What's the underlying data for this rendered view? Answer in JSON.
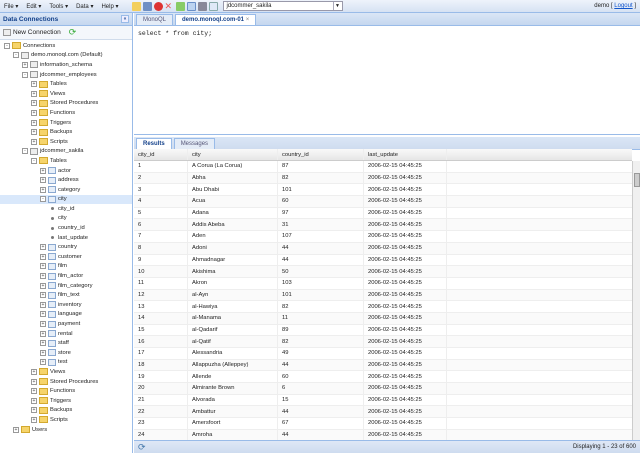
{
  "menu": [
    "File",
    "Edit",
    "Tools",
    "Data",
    "Help"
  ],
  "db_select": "jdcommer_sakila",
  "user": {
    "name": "demo",
    "logout": "Logout"
  },
  "left": {
    "title": "Data Connections",
    "new_connection": "New Connection"
  },
  "tree": [
    {
      "l": 0,
      "t": "f",
      "s": "-",
      "label": "Connections"
    },
    {
      "l": 1,
      "t": "d",
      "s": "-",
      "label": "demo.monoql.com (Default)"
    },
    {
      "l": 2,
      "t": "d",
      "s": "+",
      "label": "information_schema"
    },
    {
      "l": 2,
      "t": "d",
      "s": "-",
      "label": "jdcommer_employees"
    },
    {
      "l": 3,
      "t": "f",
      "s": "+",
      "label": "Tables"
    },
    {
      "l": 3,
      "t": "f",
      "s": "+",
      "label": "Views"
    },
    {
      "l": 3,
      "t": "f",
      "s": "+",
      "label": "Stored Procedures"
    },
    {
      "l": 3,
      "t": "f",
      "s": "+",
      "label": "Functions"
    },
    {
      "l": 3,
      "t": "f",
      "s": "+",
      "label": "Triggers"
    },
    {
      "l": 3,
      "t": "f",
      "s": "+",
      "label": "Backups"
    },
    {
      "l": 3,
      "t": "f",
      "s": "+",
      "label": "Scripts"
    },
    {
      "l": 2,
      "t": "d",
      "s": "-",
      "label": "jdcommer_sakila"
    },
    {
      "l": 3,
      "t": "f",
      "s": "-",
      "label": "Tables"
    },
    {
      "l": 4,
      "t": "t",
      "s": "+",
      "label": "actor"
    },
    {
      "l": 4,
      "t": "t",
      "s": "+",
      "label": "address"
    },
    {
      "l": 4,
      "t": "t",
      "s": "+",
      "label": "category"
    },
    {
      "l": 4,
      "t": "t",
      "s": "-",
      "label": "city",
      "sel": true
    },
    {
      "l": 5,
      "t": "c",
      "label": "city_id"
    },
    {
      "l": 5,
      "t": "c",
      "label": "city"
    },
    {
      "l": 5,
      "t": "c",
      "label": "country_id"
    },
    {
      "l": 5,
      "t": "c",
      "label": "last_update"
    },
    {
      "l": 4,
      "t": "t",
      "s": "+",
      "label": "country"
    },
    {
      "l": 4,
      "t": "t",
      "s": "+",
      "label": "customer"
    },
    {
      "l": 4,
      "t": "t",
      "s": "+",
      "label": "film"
    },
    {
      "l": 4,
      "t": "t",
      "s": "+",
      "label": "film_actor"
    },
    {
      "l": 4,
      "t": "t",
      "s": "+",
      "label": "film_category"
    },
    {
      "l": 4,
      "t": "t",
      "s": "+",
      "label": "film_text"
    },
    {
      "l": 4,
      "t": "t",
      "s": "+",
      "label": "inventory"
    },
    {
      "l": 4,
      "t": "t",
      "s": "+",
      "label": "language"
    },
    {
      "l": 4,
      "t": "t",
      "s": "+",
      "label": "payment"
    },
    {
      "l": 4,
      "t": "t",
      "s": "+",
      "label": "rental"
    },
    {
      "l": 4,
      "t": "t",
      "s": "+",
      "label": "staff"
    },
    {
      "l": 4,
      "t": "t",
      "s": "+",
      "label": "store"
    },
    {
      "l": 4,
      "t": "t",
      "s": "+",
      "label": "test"
    },
    {
      "l": 3,
      "t": "f",
      "s": "+",
      "label": "Views"
    },
    {
      "l": 3,
      "t": "f",
      "s": "+",
      "label": "Stored Procedures"
    },
    {
      "l": 3,
      "t": "f",
      "s": "+",
      "label": "Functions"
    },
    {
      "l": 3,
      "t": "f",
      "s": "+",
      "label": "Triggers"
    },
    {
      "l": 3,
      "t": "f",
      "s": "+",
      "label": "Backups"
    },
    {
      "l": 3,
      "t": "f",
      "s": "+",
      "label": "Scripts"
    },
    {
      "l": 1,
      "t": "f",
      "s": "+",
      "label": "Users"
    }
  ],
  "tabs": [
    "MonoQL",
    "demo.monoql.com-01"
  ],
  "editor": {
    "sql": "select * from city;"
  },
  "result_tabs": [
    "Results",
    "Messages"
  ],
  "columns": [
    "city_id",
    "city",
    "country_id",
    "last_update"
  ],
  "rows": [
    [
      "1",
      "A Corua (La Corua)",
      "87",
      "2006-02-15 04:45:25"
    ],
    [
      "2",
      "Abha",
      "82",
      "2006-02-15 04:45:25"
    ],
    [
      "3",
      "Abu Dhabi",
      "101",
      "2006-02-15 04:45:25"
    ],
    [
      "4",
      "Acua",
      "60",
      "2006-02-15 04:45:25"
    ],
    [
      "5",
      "Adana",
      "97",
      "2006-02-15 04:45:25"
    ],
    [
      "6",
      "Addis Abeba",
      "31",
      "2006-02-15 04:45:25"
    ],
    [
      "7",
      "Aden",
      "107",
      "2006-02-15 04:45:25"
    ],
    [
      "8",
      "Adoni",
      "44",
      "2006-02-15 04:45:25"
    ],
    [
      "9",
      "Ahmadnagar",
      "44",
      "2006-02-15 04:45:25"
    ],
    [
      "10",
      "Akishima",
      "50",
      "2006-02-15 04:45:25"
    ],
    [
      "11",
      "Akron",
      "103",
      "2006-02-15 04:45:25"
    ],
    [
      "12",
      "al-Ayn",
      "101",
      "2006-02-15 04:45:25"
    ],
    [
      "13",
      "al-Hawiya",
      "82",
      "2006-02-15 04:45:25"
    ],
    [
      "14",
      "al-Manama",
      "11",
      "2006-02-15 04:45:25"
    ],
    [
      "15",
      "al-Qadarif",
      "89",
      "2006-02-15 04:45:25"
    ],
    [
      "16",
      "al-Qatif",
      "82",
      "2006-02-15 04:45:25"
    ],
    [
      "17",
      "Alessandria",
      "49",
      "2006-02-15 04:45:25"
    ],
    [
      "18",
      "Allappuzha (Alleppey)",
      "44",
      "2006-02-15 04:45:25"
    ],
    [
      "19",
      "Allende",
      "60",
      "2006-02-15 04:45:25"
    ],
    [
      "20",
      "Almirante Brown",
      "6",
      "2006-02-15 04:45:25"
    ],
    [
      "21",
      "Alvorada",
      "15",
      "2006-02-15 04:45:25"
    ],
    [
      "22",
      "Ambattur",
      "44",
      "2006-02-15 04:45:25"
    ],
    [
      "23",
      "Amersfoort",
      "67",
      "2006-02-15 04:45:25"
    ],
    [
      "24",
      "Amroha",
      "44",
      "2006-02-15 04:45:25"
    ]
  ],
  "footer": {
    "display": "Displaying 1 - 23 of 600"
  }
}
